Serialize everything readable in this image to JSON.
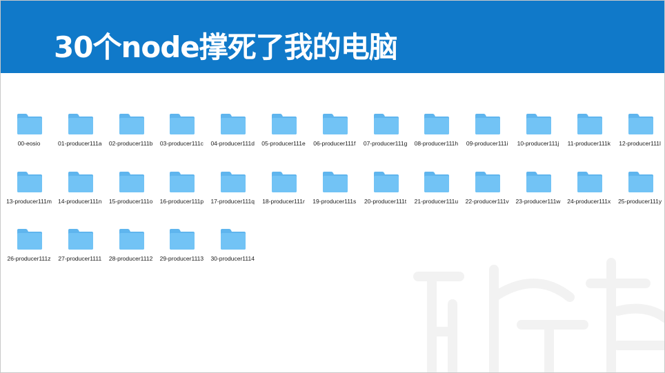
{
  "slide": {
    "title": "30个node撑死了我的电脑"
  },
  "colors": {
    "header_background": "#1079c9",
    "folder_front": "#72c3f5",
    "folder_back": "#5fb5ee"
  },
  "folders": [
    {
      "label": "00-eosio"
    },
    {
      "label": "01-producer111a"
    },
    {
      "label": "02-producer111b"
    },
    {
      "label": "03-producer111c"
    },
    {
      "label": "04-producer111d"
    },
    {
      "label": "05-producer111e"
    },
    {
      "label": "06-producer111f"
    },
    {
      "label": "07-producer111g"
    },
    {
      "label": "08-producer111h"
    },
    {
      "label": "09-producer111i"
    },
    {
      "label": "10-producer111j"
    },
    {
      "label": "11-producer111k"
    },
    {
      "label": "12-producer111l"
    },
    {
      "label": "13-producer111m"
    },
    {
      "label": "14-producer111n"
    },
    {
      "label": "15-producer111o"
    },
    {
      "label": "16-producer111p"
    },
    {
      "label": "17-producer111q"
    },
    {
      "label": "18-producer111r"
    },
    {
      "label": "19-producer111s"
    },
    {
      "label": "20-producer111t"
    },
    {
      "label": "21-producer111u"
    },
    {
      "label": "22-producer111v"
    },
    {
      "label": "23-producer111w"
    },
    {
      "label": "24-producer111x"
    },
    {
      "label": "25-producer111y"
    },
    {
      "label": "26-producer111z"
    },
    {
      "label": "27-producer1111"
    },
    {
      "label": "28-producer1112"
    },
    {
      "label": "29-producer1113"
    },
    {
      "label": "30-producer1114"
    }
  ]
}
